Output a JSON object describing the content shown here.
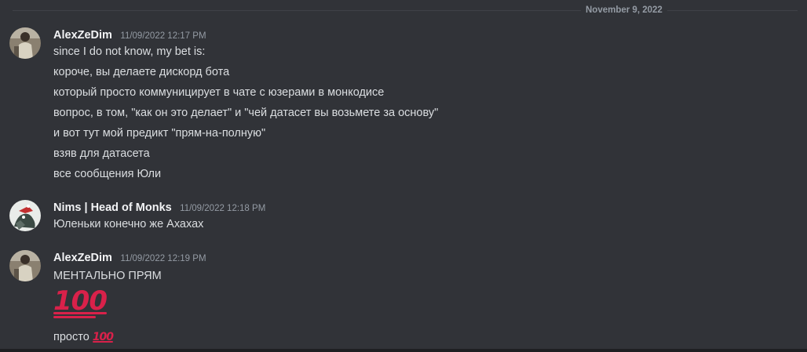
{
  "date_divider": "November 9, 2022",
  "emoji": {
    "hundred": "💯"
  },
  "messages": [
    {
      "author": "AlexZeDim",
      "timestamp": "11/09/2022 12:17 PM",
      "lines": [
        "since I do not know, my bet is:",
        "короче, вы делаете дискорд бота",
        "который просто коммуницирует в чате с юзерами в монкодисе",
        "вопрос, в том, \"как он это делает\" и \"чей датасет вы возьмете за основу\"",
        "и вот тут мой предикт \"прям-на-полную\"",
        "взяв для датасета",
        "все сообщения Юли"
      ]
    },
    {
      "author": "Nims | Head of Monks",
      "timestamp": "11/09/2022 12:18 PM",
      "lines": [
        "Юленьки конечно же Ахахах"
      ]
    },
    {
      "author": "AlexZeDim",
      "timestamp": "11/09/2022 12:19 PM",
      "lines": [
        "МЕНТАЛЬНО ПРЯМ",
        "просто"
      ]
    }
  ]
}
